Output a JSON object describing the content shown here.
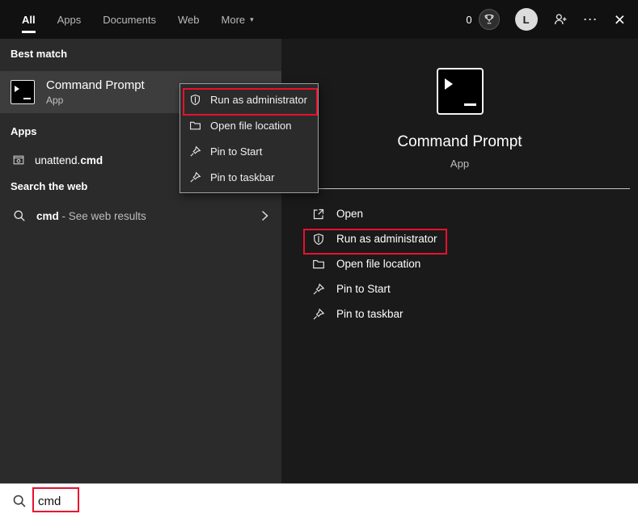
{
  "colors": {
    "annotation": "#e8112d"
  },
  "glyphs": {
    "caret_down": "▾",
    "ellipsis": "⋯",
    "close": "×"
  },
  "topbar": {
    "tabs": [
      {
        "label": "All",
        "active": true
      },
      {
        "label": "Apps",
        "active": false
      },
      {
        "label": "Documents",
        "active": false
      },
      {
        "label": "Web",
        "active": false
      },
      {
        "label": "More",
        "active": false,
        "has_caret": true
      }
    ],
    "rewards_count": "0",
    "avatar_letter": "L"
  },
  "left_panel": {
    "sections": {
      "best_match": "Best match",
      "apps": "Apps",
      "web": "Search the web"
    },
    "best_match_item": {
      "title": "Command Prompt",
      "subtitle": "App",
      "icon": "command-prompt"
    },
    "context_menu": {
      "items": [
        {
          "label": "Run as administrator",
          "icon": "admin-shield",
          "annotated": true
        },
        {
          "label": "Open file location",
          "icon": "folder"
        },
        {
          "label": "Pin to Start",
          "icon": "pin"
        },
        {
          "label": "Pin to taskbar",
          "icon": "pin"
        }
      ]
    },
    "apps_item": {
      "prefix": "unattend.",
      "match": "cmd",
      "icon": "cmd-file"
    },
    "web_item": {
      "query": "cmd",
      "suffix": " - See web results",
      "icon": "search"
    }
  },
  "preview": {
    "title": "Command Prompt",
    "subtitle": "App",
    "icon": "command-prompt",
    "actions": [
      {
        "label": "Open",
        "icon": "open"
      },
      {
        "label": "Run as administrator",
        "icon": "admin-shield",
        "annotated": true
      },
      {
        "label": "Open file location",
        "icon": "folder"
      },
      {
        "label": "Pin to Start",
        "icon": "pin"
      },
      {
        "label": "Pin to taskbar",
        "icon": "pin"
      }
    ]
  },
  "searchbar": {
    "value": "cmd"
  }
}
